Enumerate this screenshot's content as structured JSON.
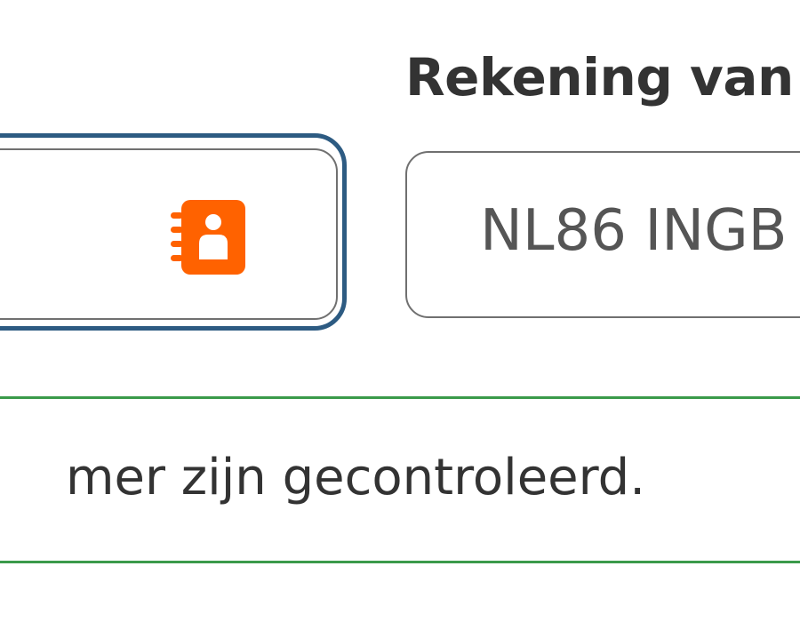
{
  "form": {
    "account_from_label": "Rekening van",
    "account_from_value": "NL86 INGB",
    "contact_icon": "contacts-book-icon"
  },
  "notice": {
    "text": "mer zijn gecontroleerd."
  },
  "colors": {
    "focus_border": "#2d5b82",
    "icon_orange": "#ff6200",
    "success_rule": "#3a9a4a",
    "field_border": "#707070",
    "text_dark": "#333333"
  }
}
